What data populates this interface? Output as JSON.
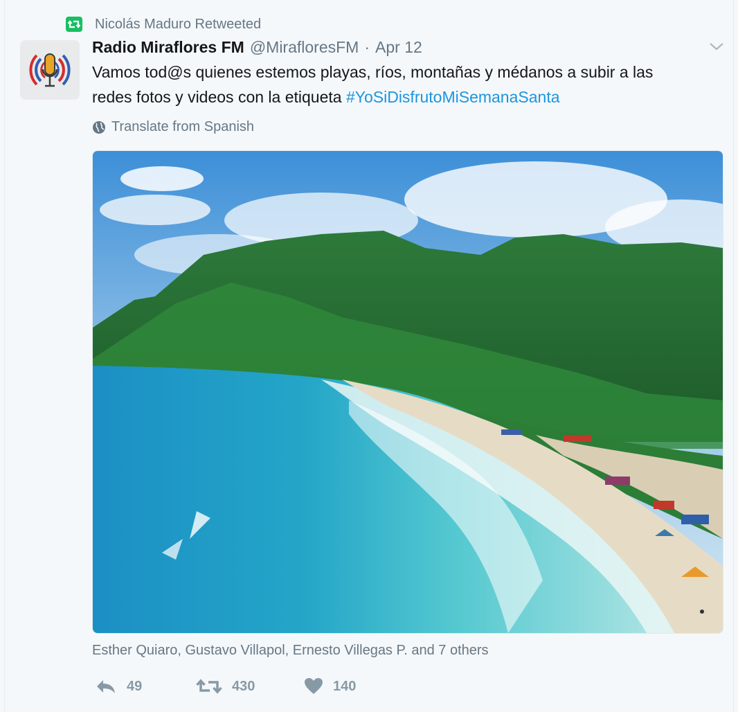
{
  "retweet": {
    "label": "Nicolás Maduro Retweeted",
    "icon": "retweet-icon"
  },
  "tweet": {
    "author_name": "Radio Miraflores FM",
    "author_handle": "@MirafloresFM",
    "separator": "·",
    "date": "Apr 12",
    "text_line1": "Vamos tod@s quienes estemos  playas, ríos, montañas y médanos a subir a las",
    "text_line2_prefix": "redes fotos y videos con la etiqueta ",
    "hashtag": "#YoSiDisfrutoMiSemanaSanta",
    "translate_label": "Translate from Spanish",
    "tagged_users": "Esther Quiaro, Gustavo Villapol, Ernesto Villegas P. and 7 others",
    "media_description_icon": "photo"
  },
  "actions": {
    "reply_count": "49",
    "retweet_count": "430",
    "like_count": "140"
  },
  "colors": {
    "retweet_green": "#17bf63",
    "link_blue": "#1b95e0",
    "muted_gray": "#657786",
    "action_gray": "#8899a6"
  }
}
